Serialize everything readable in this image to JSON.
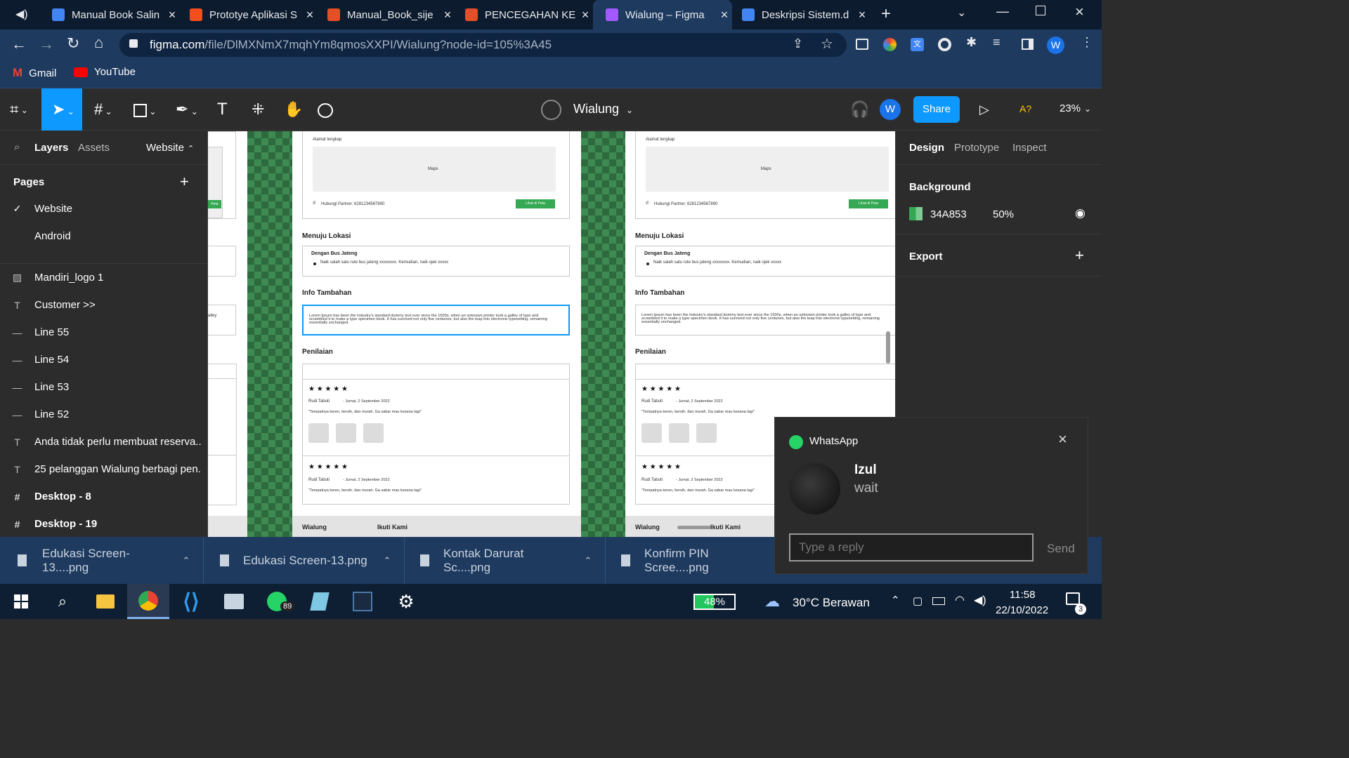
{
  "browser": {
    "tabs": [
      {
        "title": "Manual Book Salin",
        "color": "#4285f4"
      },
      {
        "title": "Prototye Aplikasi S",
        "color": "#f24e1e"
      },
      {
        "title": "Manual_Book_sije",
        "color": "#e34f26"
      },
      {
        "title": "PENCEGAHAN KE",
        "color": "#e34f26"
      },
      {
        "title": "Wialung – Figma",
        "color": "#a259ff"
      },
      {
        "title": "Deskripsi Sistem.d",
        "color": "#4285f4"
      }
    ],
    "url_host": "figma.com",
    "url_path": "/file/DlMXNmX7mqhYm8qmosXXPI/Wialung?node-id=105%3A45",
    "bookmarks": [
      {
        "label": "Gmail"
      },
      {
        "label": "YouTube"
      }
    ],
    "profile_initial": "W"
  },
  "figma": {
    "file_name": "Wialung",
    "user_initial": "W",
    "share_label": "Share",
    "a_label": "A?",
    "zoom": "23%",
    "left_tabs": {
      "layers": "Layers",
      "assets": "Assets",
      "page_switch": "Website"
    },
    "pages_title": "Pages",
    "pages": [
      {
        "name": "Website",
        "selected": true
      },
      {
        "name": "Android",
        "selected": false
      }
    ],
    "layers": [
      {
        "icon": "image",
        "name": "Mandiri_logo 1"
      },
      {
        "icon": "text",
        "name": "Customer >>"
      },
      {
        "icon": "line",
        "name": "Line 55"
      },
      {
        "icon": "line",
        "name": "Line 54"
      },
      {
        "icon": "line",
        "name": "Line 53"
      },
      {
        "icon": "line",
        "name": "Line 52"
      },
      {
        "icon": "text",
        "name": "Anda tidak perlu membuat reserva..."
      },
      {
        "icon": "text",
        "name": "25 pelanggan Wialung berbagi pen..."
      },
      {
        "icon": "frame",
        "name": "Desktop - 8"
      },
      {
        "icon": "frame",
        "name": "Desktop - 19"
      }
    ],
    "right_tabs": {
      "design": "Design",
      "prototype": "Prototype",
      "inspect": "Inspect"
    },
    "background_label": "Background",
    "background_hex": "34A853",
    "background_opacity": "50%",
    "export_label": "Export"
  },
  "canvas": {
    "alamat": "Alamat lengkap",
    "maps": "Maps",
    "hubungi": "Hubungi Partner: 6281234567890",
    "lihat": "Lihat di Peta",
    "peta": "Peta",
    "menuju": "Menuju Lokasi",
    "bus_title": "Dengan Bus Jateng",
    "bus_desc": "Naik salah satu rute bus jateng xxxxxxxx. Kemudian, naik ojek xxxxx",
    "info": "Info Tambahan",
    "lorem": "Lorem Ipsum has been the industry's standard dummy text ever since the 1500s, when an unknown printer took a galley of type and scrambled it to make a type specimen book. It has survived not only five centuries, but also the leap into electronic typesetting, remaining essentially unchanged.",
    "penilaian": "Penilaian",
    "stars": "★ ★ ★ ★ ★",
    "reviewer": "Rudi Tabuti",
    "date": "- Jumat, 2 September 2022",
    "review": "\"Tempatnya keren, bersih, dan  murah. Ga sabar mau kesana lagi\"",
    "footer_left": "Wialung",
    "footer_right": "Ikuti Kami",
    "alley": "alley"
  },
  "downloads": [
    {
      "name": "Edukasi Screen-13....png"
    },
    {
      "name": "Edukasi Screen-13.png"
    },
    {
      "name": "Kontak Darurat Sc....png"
    },
    {
      "name": "Konfirm PIN Scree....png"
    }
  ],
  "whatsapp": {
    "app": "WhatsApp",
    "sender": "Izul",
    "message": "wait",
    "reply_placeholder": "Type a reply",
    "send": "Send"
  },
  "taskbar": {
    "whatsapp_badge": "89",
    "battery": "48%",
    "weather": "30°C  Berawan",
    "time": "11:58",
    "date": "22/10/2022",
    "notif_count": "3"
  }
}
